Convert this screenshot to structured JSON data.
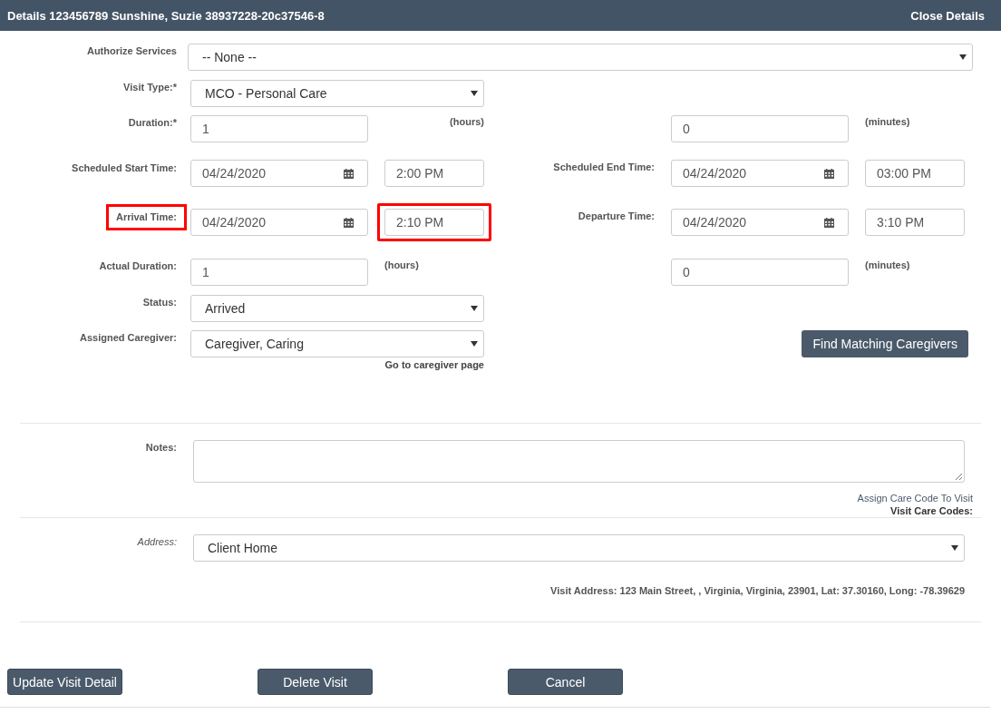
{
  "header": {
    "title": "Details 123456789 Sunshine, Suzie 38937228-20c37546-8",
    "close": "Close Details"
  },
  "rows": [
    {
      "kind": "select-wide",
      "label": "Authorize Services",
      "value": "-- None --"
    },
    {
      "kind": "select",
      "label": "Visit Type:*",
      "value": "MCO - Personal Care"
    },
    {
      "kind": "duration",
      "label": "Duration:*",
      "hours": "1",
      "hours_unit": "(hours)",
      "minutes": "0",
      "minutes_unit": "(minutes)"
    },
    {
      "kind": "datetime",
      "label": "Scheduled Start Time:",
      "date": "04/24/2020",
      "time": "2:00 PM",
      "label_highlighted": false,
      "time_highlighted": false,
      "right_label": "Scheduled End Time:",
      "right_date": "04/24/2020",
      "right_time": "03:00 PM"
    },
    {
      "kind": "datetime",
      "label": "Arrival Time:",
      "date": "04/24/2020",
      "time": "2:10 PM",
      "label_highlighted": true,
      "time_highlighted": true,
      "right_label": "Departure Time:",
      "right_date": "04/24/2020",
      "right_time": "3:10 PM"
    },
    {
      "kind": "duration",
      "label": "Actual Duration:",
      "hours": "1",
      "hours_unit": "(hours)",
      "minutes": "0",
      "minutes_unit": "(minutes)"
    },
    {
      "kind": "select",
      "label": "Status:",
      "value": "Arrived"
    },
    {
      "kind": "caregiver",
      "label": "Assigned Caregiver:",
      "value": "Caregiver, Caring",
      "link": "Go to caregiver page",
      "button": "Find Matching Caregivers"
    }
  ],
  "notes": {
    "label": "Notes:",
    "link": "Assign Care Code To Visit",
    "codes_label": "Visit Care Codes:"
  },
  "address": {
    "label": "Address:",
    "value": "Client Home",
    "visit_address": "Visit Address: 123 Main Street, , Virginia, Virginia, 23901, Lat: 37.30160, Long: -78.39629"
  },
  "buttons": [
    "Update Visit Detail",
    "Delete Visit",
    "Cancel"
  ]
}
